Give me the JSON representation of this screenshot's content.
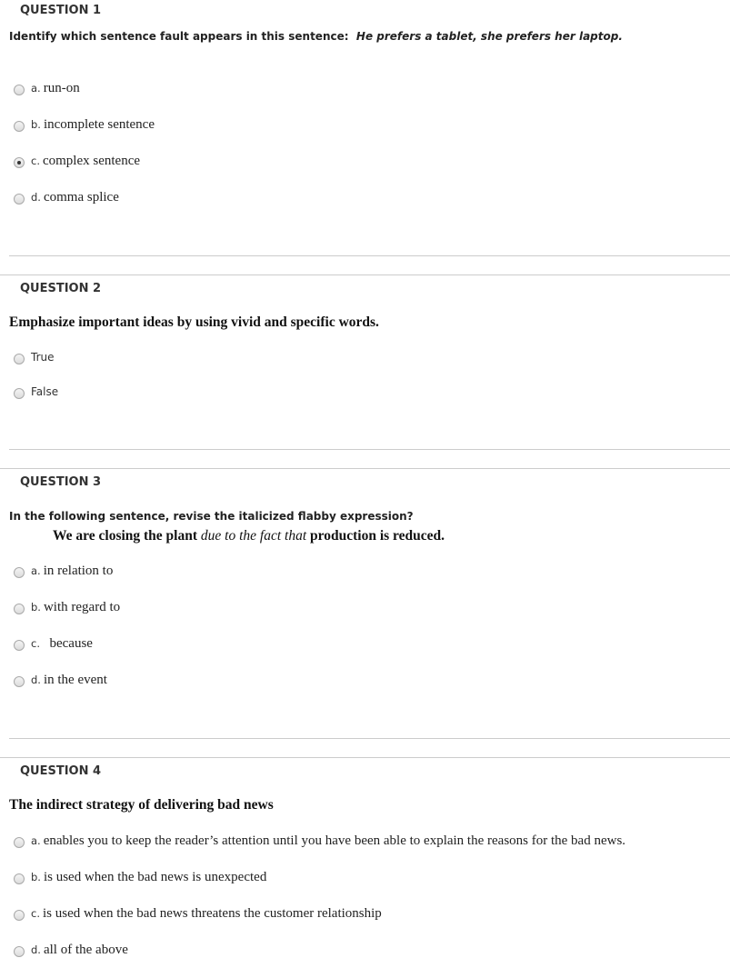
{
  "questions": [
    {
      "heading": "QUESTION 1",
      "prompt": "Identify which sentence fault appears in this sentence:",
      "prompt_example": "He prefers a tablet, she prefers her laptop.",
      "options": [
        {
          "letter": "a.",
          "text": "run-on",
          "selected": false
        },
        {
          "letter": "b.",
          "text": "incomplete sentence",
          "selected": false
        },
        {
          "letter": "c.",
          "text": "complex sentence",
          "selected": true
        },
        {
          "letter": "d.",
          "text": "comma splice",
          "selected": false
        }
      ]
    },
    {
      "heading": "QUESTION 2",
      "prompt": "Emphasize important ideas by using vivid and specific words.",
      "options": [
        {
          "letter": "",
          "text": "True",
          "selected": false
        },
        {
          "letter": "",
          "text": "False",
          "selected": false
        }
      ]
    },
    {
      "heading": "QUESTION 3",
      "prompt": "In the following sentence, revise the italicized flabby expression?",
      "sentence_before": "We are closing the plant ",
      "sentence_italic": "due to the fact that",
      "sentence_after": " production is reduced.",
      "options": [
        {
          "letter": "a.",
          "text": "in relation to",
          "selected": false
        },
        {
          "letter": "b.",
          "text": "with regard to",
          "selected": false
        },
        {
          "letter": "c.",
          "text": "  because",
          "selected": false
        },
        {
          "letter": "d.",
          "text": "in the event",
          "selected": false
        }
      ]
    },
    {
      "heading": "QUESTION 4",
      "prompt": "The indirect strategy of delivering bad news",
      "options": [
        {
          "letter": "a.",
          "text": "enables you to keep the reader’s attention until you have been able to explain the reasons for the bad news.",
          "selected": false
        },
        {
          "letter": "b.",
          "text": "is used when the bad news is unexpected",
          "selected": false
        },
        {
          "letter": "c.",
          "text": "is used when the bad news threatens the customer relationship",
          "selected": false
        },
        {
          "letter": "d.",
          "text": "all of the above",
          "selected": false
        }
      ]
    }
  ]
}
